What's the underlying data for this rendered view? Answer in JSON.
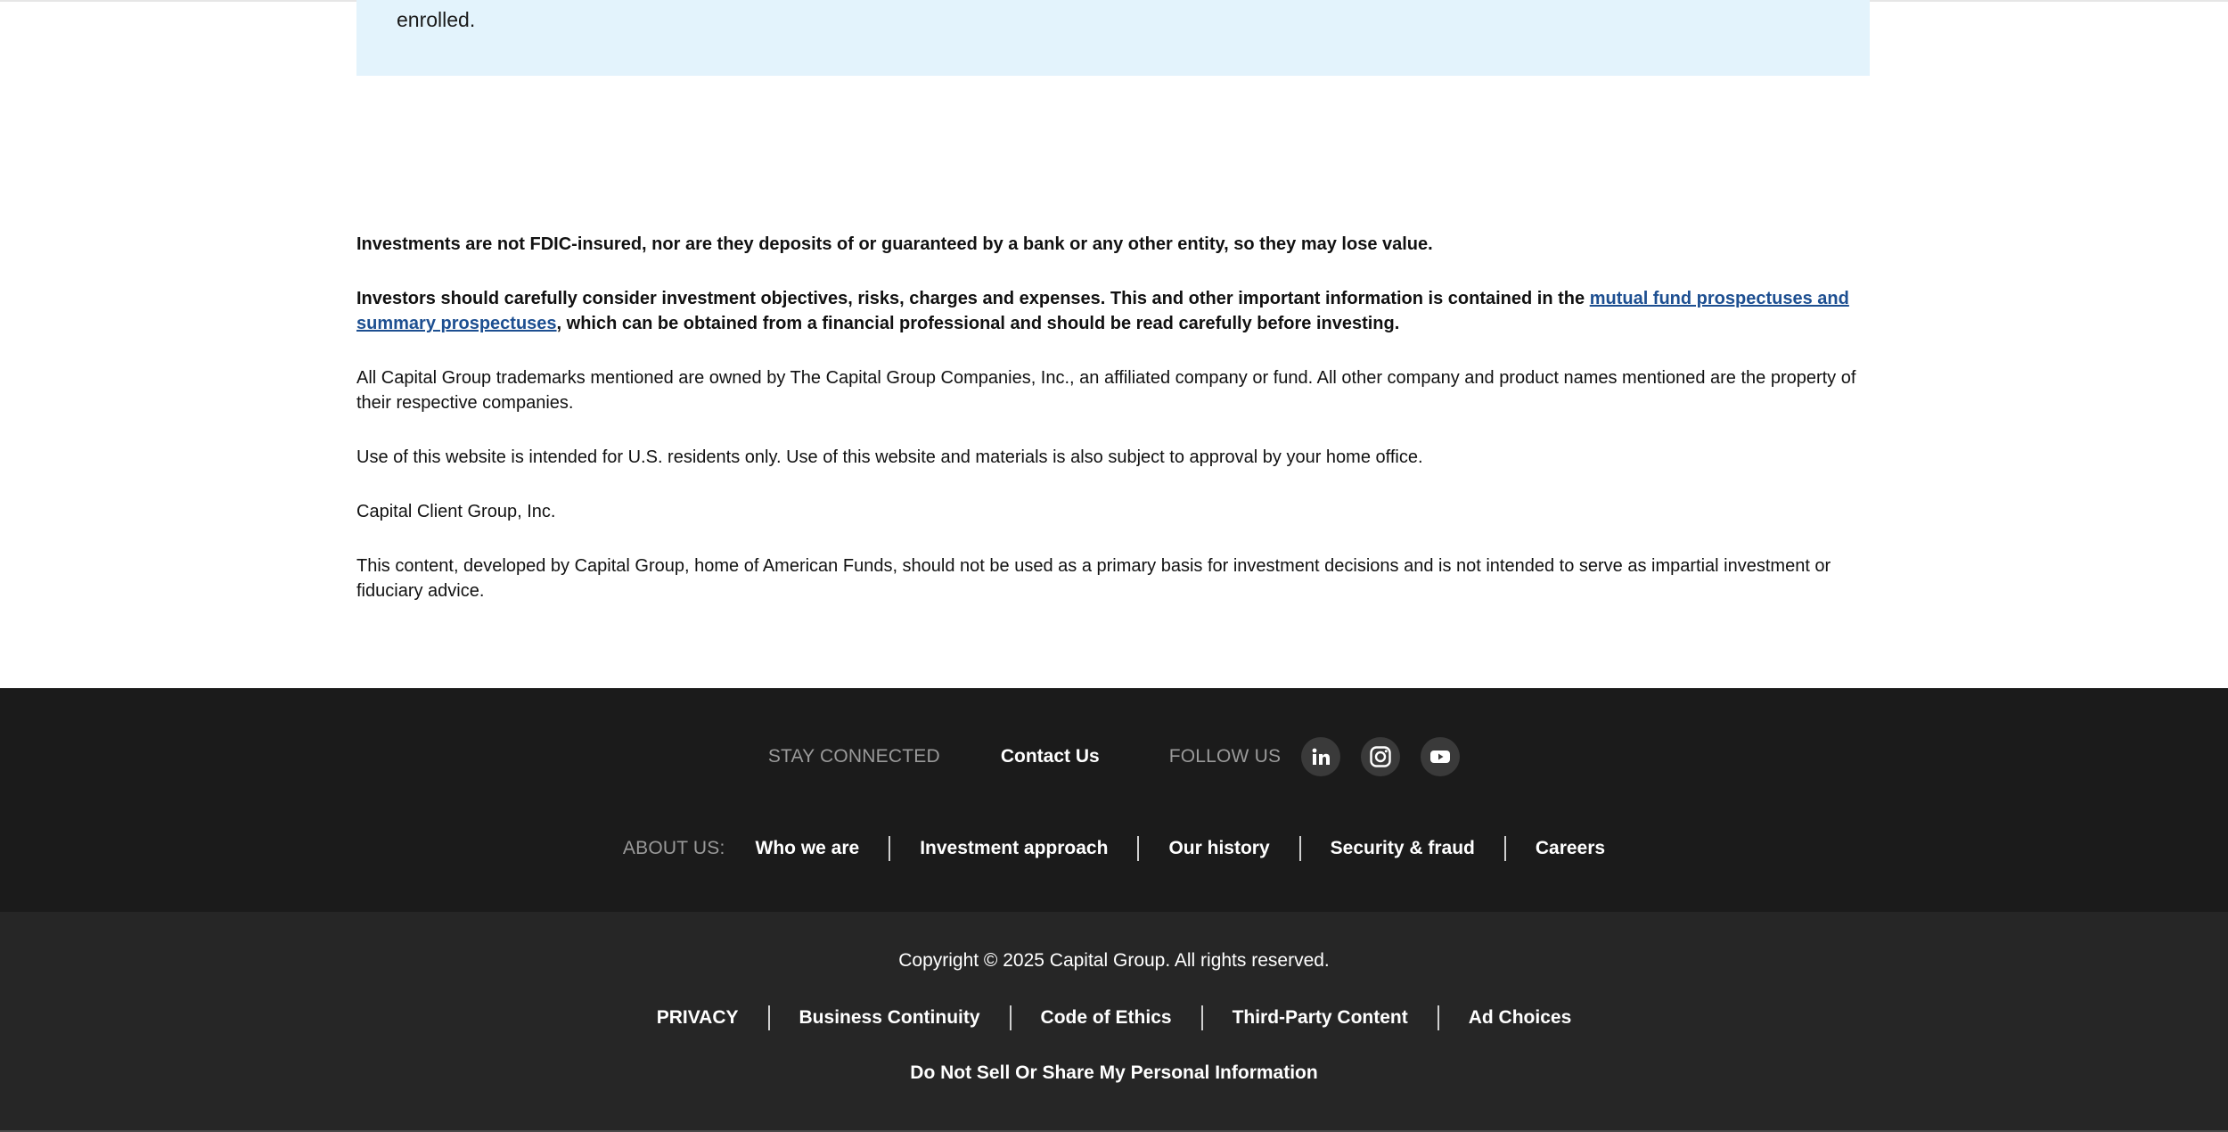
{
  "info_box": {
    "text": "enrolled."
  },
  "disclosures": {
    "fdic": "Investments are not FDIC-insured, nor are they deposits of or guaranteed by a bank or any other entity, so they may lose value.",
    "investors_pre": "Investors should carefully consider investment objectives, risks, charges and expenses. This and other important information is contained in the ",
    "investors_link": "mutual fund prospectuses and summary prospectuses",
    "investors_post": ", which can be obtained from a financial professional and should be read carefully before investing.",
    "trademarks": "All Capital Group trademarks mentioned are owned by The Capital Group Companies, Inc., an affiliated company or fund. All other company and product names mentioned are the property of their respective companies.",
    "residents": "Use of this website is intended for U.S. residents only. Use of this website and materials is also subject to approval by your home office.",
    "entity": "Capital Client Group, Inc.",
    "content": "This content, developed by Capital Group, home of American Funds, should not be used as a primary basis for investment decisions and is not intended to serve as impartial investment or fiduciary advice."
  },
  "footer": {
    "stay_connected": "STAY CONNECTED",
    "contact_us": "Contact Us",
    "follow_us": "FOLLOW US",
    "social": [
      {
        "name": "linkedin-icon"
      },
      {
        "name": "instagram-icon"
      },
      {
        "name": "youtube-icon"
      }
    ],
    "about_label": "ABOUT US:",
    "about_links": [
      "Who we are",
      "Investment approach",
      "Our history",
      "Security & fraud",
      "Careers"
    ],
    "copyright": "Copyright © 2025 Capital Group. All rights reserved.",
    "legal_links": [
      "PRIVACY",
      "Business Continuity",
      "Code of Ethics",
      "Third-Party Content",
      "Ad Choices"
    ],
    "do_not_sell": "Do Not Sell Or Share My Personal Information"
  },
  "colors": {
    "link": "#1d4f91",
    "info_box_bg": "#e3f3fc",
    "footer_top_bg": "#1b1b1b",
    "footer_bottom_bg": "#262626"
  }
}
